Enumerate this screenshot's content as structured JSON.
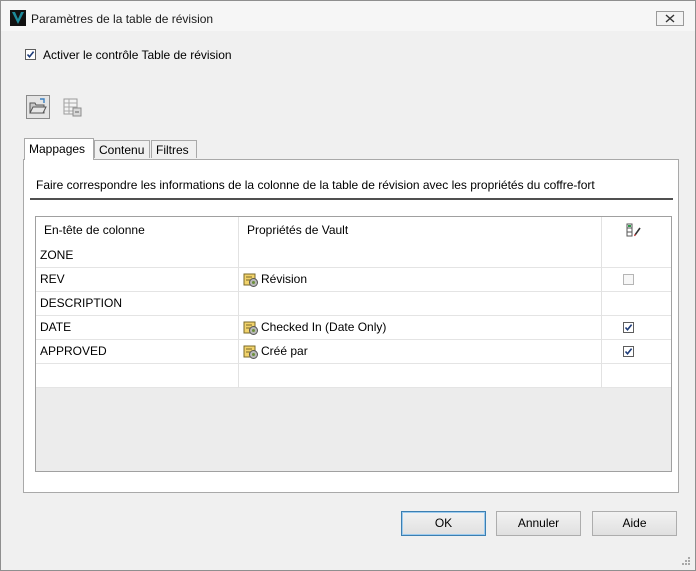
{
  "window": {
    "title": "Paramètres de la table de révision"
  },
  "enable_control": {
    "label": "Activer le contrôle Table de révision",
    "checked": true
  },
  "toolbar": {
    "icons": [
      "open-folder-icon",
      "table-settings-icon"
    ]
  },
  "tabs": [
    {
      "label": "Mappages",
      "active": true
    },
    {
      "label": "Contenu",
      "active": false
    },
    {
      "label": "Filtres",
      "active": false
    }
  ],
  "mappings": {
    "description": "Faire correspondre les informations de la colonne de la table de révision avec les propriétés du coffre-fort",
    "columns": {
      "header": "En-tête de colonne",
      "vault": "Propriétés de Vault",
      "edit_icon": "column-edit-icon"
    },
    "rows": [
      {
        "header": "ZONE",
        "vault": "",
        "has_check": false,
        "checked": false,
        "enabled": false
      },
      {
        "header": "REV",
        "vault": "Révision",
        "has_check": true,
        "checked": false,
        "enabled": false
      },
      {
        "header": "DESCRIPTION",
        "vault": "",
        "has_check": false,
        "checked": false,
        "enabled": false
      },
      {
        "header": "DATE",
        "vault": "Checked In (Date Only)",
        "has_check": true,
        "checked": true,
        "enabled": true
      },
      {
        "header": "APPROVED",
        "vault": "Créé par",
        "has_check": true,
        "checked": true,
        "enabled": true
      },
      {
        "header": "",
        "vault": "",
        "has_check": false,
        "checked": false,
        "enabled": false
      }
    ]
  },
  "buttons": {
    "ok": "OK",
    "cancel": "Annuler",
    "help": "Aide"
  },
  "colors": {
    "title_icon_teal": "#1d8a9a",
    "default_button_border": "#3c7fb1"
  }
}
